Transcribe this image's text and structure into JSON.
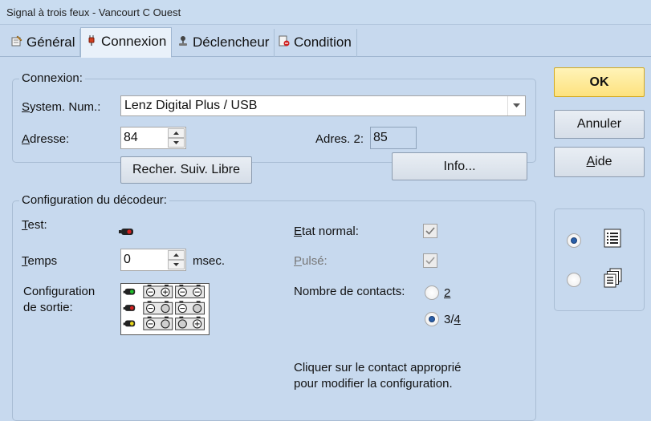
{
  "window": {
    "title": "Signal à trois feux - Vancourt C Ouest"
  },
  "tabs": [
    {
      "label": "Général",
      "icon": "document-pencil-icon"
    },
    {
      "label": "Connexion",
      "icon": "plug-icon"
    },
    {
      "label": "Déclencheur",
      "icon": "joystick-icon"
    },
    {
      "label": "Condition",
      "icon": "document-no-icon"
    }
  ],
  "connexion": {
    "legend": "Connexion:",
    "system_label_u": "S",
    "system_label_rest": "ystem. Num.:",
    "system_value": "Lenz Digital Plus / USB",
    "address_label_u": "A",
    "address_label_rest": "dresse:",
    "address_value": "84",
    "address2_label": "Adres. 2:",
    "address2_value": "85",
    "search_button": "Recher. Suiv. Libre",
    "info_button": "Info..."
  },
  "decoder": {
    "legend": "Configuration du décodeur:",
    "test_label_u": "T",
    "test_label_rest": "est:",
    "time_label_u": "T",
    "time_label_rest": "emps",
    "time_value": "0",
    "time_unit": "msec.",
    "output_config_label_1": "Configuration",
    "output_config_label_2": "de sortie:",
    "normal_state_label_u": "E",
    "normal_state_label_rest": "tat normal:",
    "pulsed_label_u": "P",
    "pulsed_label_rest": "ulsé:",
    "contacts_label": "Nombre de contacts:",
    "contacts_option_2": "2",
    "contacts_option_34_a": "3/",
    "contacts_option_34_u": "4",
    "hint_line_1": "Cliquer sur le contact approprié",
    "hint_line_2": "pour modifier la configuration."
  },
  "buttons": {
    "ok": "OK",
    "cancel": "Annuler",
    "help_u": "A",
    "help_rest": "ide"
  },
  "colors": {
    "background": "#c7d9ee",
    "ok_button": "#fde27e",
    "signal_red": "#d62020",
    "signal_green": "#1fbf2a",
    "signal_yellow": "#e8d61a"
  }
}
